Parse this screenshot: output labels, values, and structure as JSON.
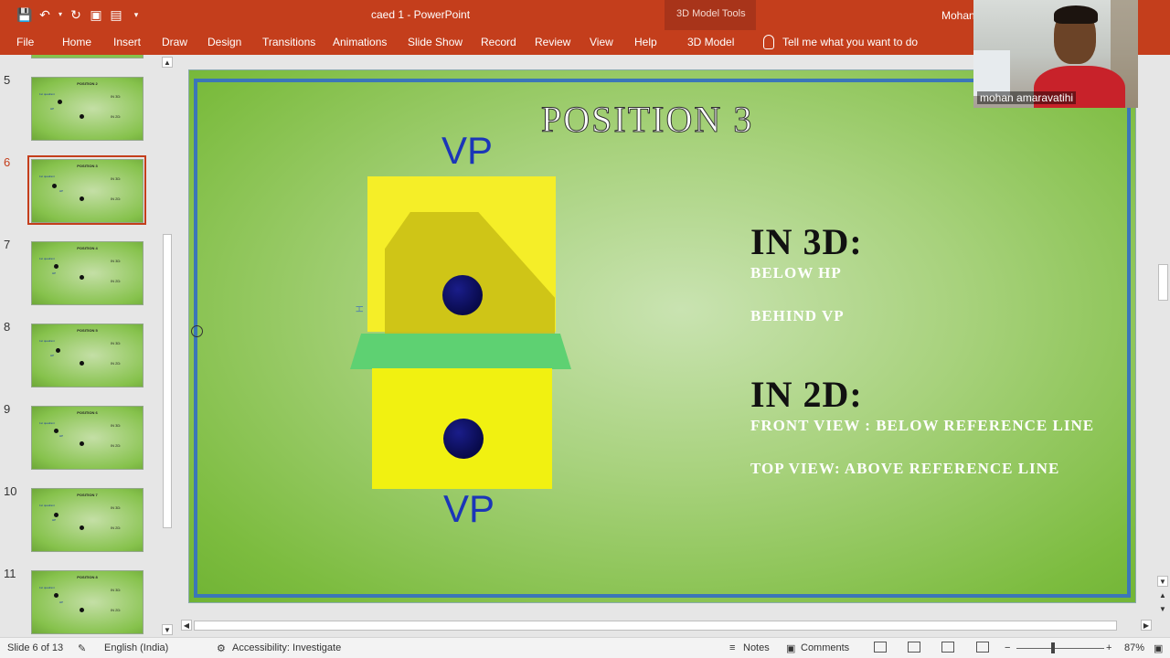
{
  "titlebar": {
    "title": "caed 1  -  PowerPoint",
    "context_label": "3D Model Tools",
    "user": "Mohan"
  },
  "qat": {
    "save_icon": "save-icon",
    "undo_icon": "undo-icon",
    "redo_icon": "redo-icon",
    "present_icon": "present-from-beginning-icon",
    "layout_icon": "layout-icon",
    "customize_icon": "customize-qat-icon"
  },
  "tabs": [
    "File",
    "Home",
    "Insert",
    "Draw",
    "Design",
    "Transitions",
    "Animations",
    "Slide Show",
    "Record",
    "Review",
    "View",
    "Help",
    "3D Model"
  ],
  "tell_me": "Tell me what you want to do",
  "thumbnails": [
    {
      "num": "5",
      "title": "POSITION 2"
    },
    {
      "num": "6",
      "title": "POSITION 3"
    },
    {
      "num": "7",
      "title": "POSITION 4"
    },
    {
      "num": "8",
      "title": "POSITION 5"
    },
    {
      "num": "9",
      "title": "POSITION 6"
    },
    {
      "num": "10",
      "title": "POSITION 7"
    },
    {
      "num": "11",
      "title": "POSITION 8"
    }
  ],
  "thumb_text": {
    "in3d": "IN 3D:",
    "in2d": "IN 2D:",
    "hp": "HP",
    "quadrant": "1st quadrant"
  },
  "slide": {
    "title": "POSITION 3",
    "vp_top": "VP",
    "vp_bottom": "VP",
    "in3d_heading": "IN 3D:",
    "in3d_line1": "BELOW HP",
    "in3d_line2": "BEHIND VP",
    "in2d_heading": "IN 2D:",
    "in2d_line1": "FRONT VIEW : BELOW REFERENCE LINE",
    "in2d_line2": "TOP VIEW: ABOVE REFERENCE LINE",
    "side_label": "H"
  },
  "webcam": {
    "name": "mohan amaravatihi"
  },
  "status": {
    "slide_info": "Slide 6 of 13",
    "language": "English (India)",
    "accessibility": "Accessibility: Investigate",
    "notes": "Notes",
    "comments": "Comments",
    "zoom": "87%"
  }
}
